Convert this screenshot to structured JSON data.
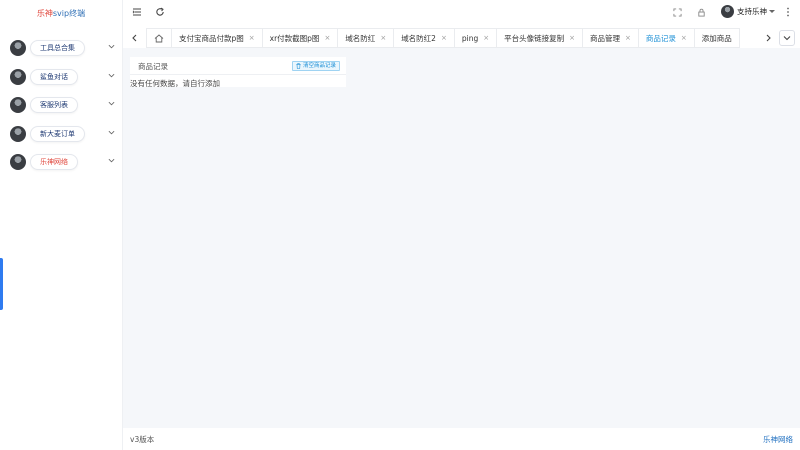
{
  "app": {
    "logo_part1": "乐神",
    "logo_part2": "svip终端"
  },
  "sidebar": {
    "items": [
      {
        "label": "工具总合集",
        "color": "#1f3a73"
      },
      {
        "label": "鲨鱼对话",
        "color": "#1f3a73"
      },
      {
        "label": "客服列表",
        "color": "#1f3a73"
      },
      {
        "label": "新大麦订单",
        "color": "#1f3a73"
      },
      {
        "label": "乐神网络",
        "color": "#e0453b"
      }
    ]
  },
  "header": {
    "menu_icon": "menu-fold-icon",
    "refresh_icon": "refresh-icon",
    "fullscreen_icon": "fullscreen-icon",
    "lock_icon": "lock-icon",
    "more_icon": "more-vertical-icon",
    "user_name": "支持乐神"
  },
  "tabs": {
    "items": [
      {
        "label": "支付宝商品付款p图",
        "active": false
      },
      {
        "label": "xr付款截图p图",
        "active": false
      },
      {
        "label": "域名防红",
        "active": false
      },
      {
        "label": "域名防红2",
        "active": false
      },
      {
        "label": "ping",
        "active": false
      },
      {
        "label": "平台头像链接复制",
        "active": false
      },
      {
        "label": "商品管理",
        "active": false
      },
      {
        "label": "商品记录",
        "active": true
      },
      {
        "label": "添加商品",
        "active": false
      }
    ],
    "close_glyph": "×"
  },
  "card": {
    "title": "商品记录",
    "clear_button": "清空商品记录",
    "empty_text": "没有任何数据，请自行添加"
  },
  "footer": {
    "version": "v3版本",
    "brand": "乐神网络"
  },
  "colors": {
    "accent": "#1e90d6",
    "brand_red": "#e0453b",
    "navy": "#1f3a73",
    "content_bg": "#f5f7fa"
  }
}
